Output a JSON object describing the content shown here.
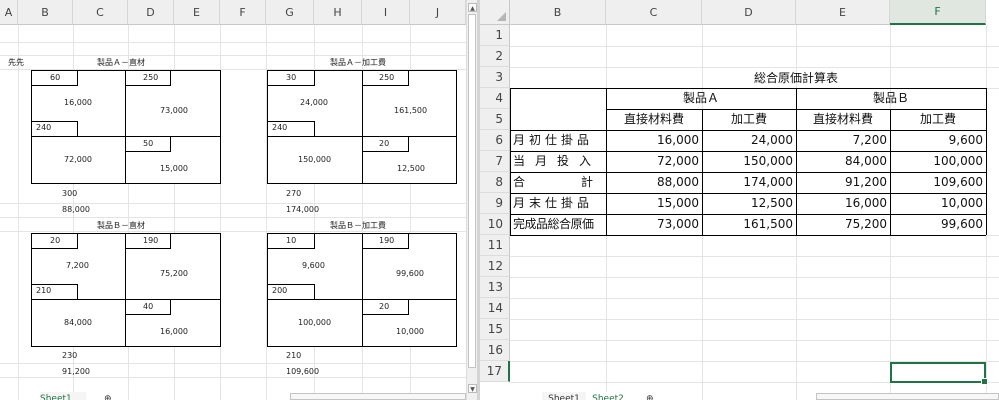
{
  "left_sheet": {
    "columns": [
      "A",
      "B",
      "C",
      "D",
      "E",
      "F",
      "G",
      "H",
      "I",
      "J"
    ],
    "stray_label": "先先",
    "boxes": [
      {
        "title": "製品Ａ－直材",
        "begin_qty": "60",
        "begin_amt": "16,000",
        "input_qty": "240",
        "input_amt": "72,000",
        "completed_qty": "250",
        "completed_amt": "73,000",
        "end_qty": "50",
        "end_amt": "15,000",
        "total_qty": "300",
        "total_amt": "88,000"
      },
      {
        "title": "製品Ａ－加工費",
        "begin_qty": "30",
        "begin_amt": "24,000",
        "input_qty": "240",
        "input_amt": "150,000",
        "completed_qty": "250",
        "completed_amt": "161,500",
        "end_qty": "20",
        "end_amt": "12,500",
        "total_qty": "270",
        "total_amt": "174,000"
      },
      {
        "title": "製品Ｂ－直材",
        "begin_qty": "20",
        "begin_amt": "7,200",
        "input_qty": "210",
        "input_amt": "84,000",
        "completed_qty": "190",
        "completed_amt": "75,200",
        "end_qty": "40",
        "end_amt": "16,000",
        "total_qty": "230",
        "total_amt": "91,200"
      },
      {
        "title": "製品Ｂ－加工費",
        "begin_qty": "10",
        "begin_amt": "9,600",
        "input_qty": "200",
        "input_amt": "100,000",
        "completed_qty": "190",
        "completed_amt": "99,600",
        "end_qty": "20",
        "end_amt": "10,000",
        "total_qty": "210",
        "total_amt": "109,600"
      }
    ],
    "tab_label": "Sheet1",
    "new_sheet_glyph": "⊕"
  },
  "right_sheet": {
    "columns": [
      "B",
      "C",
      "D",
      "E",
      "F"
    ],
    "rows": [
      "1",
      "2",
      "3",
      "4",
      "5",
      "6",
      "7",
      "8",
      "9",
      "10",
      "11",
      "12",
      "13",
      "14",
      "15",
      "16",
      "17"
    ],
    "title": "総合原価計算表",
    "product_a": "製品Ａ",
    "product_b": "製品Ｂ",
    "header_material": "直接材料費",
    "header_processing": "加工費",
    "table_rows": [
      {
        "label": "月初仕掛品",
        "a_mat": "16,000",
        "a_proc": "24,000",
        "b_mat": "7,200",
        "b_proc": "9,600"
      },
      {
        "label": "当月投入",
        "a_mat": "72,000",
        "a_proc": "150,000",
        "b_mat": "84,000",
        "b_proc": "100,000"
      },
      {
        "label": "合計",
        "a_mat": "88,000",
        "a_proc": "174,000",
        "b_mat": "91,200",
        "b_proc": "109,600"
      },
      {
        "label": "月末仕掛品",
        "a_mat": "15,000",
        "a_proc": "12,500",
        "b_mat": "16,000",
        "b_proc": "10,000"
      },
      {
        "label": "完成品総合原価",
        "a_mat": "73,000",
        "a_proc": "161,500",
        "b_mat": "75,200",
        "b_proc": "99,600"
      }
    ],
    "tabs": [
      "Sheet1",
      "Sheet2"
    ],
    "new_sheet_glyph": "⊕"
  },
  "colors": {
    "accent": "#217346",
    "header_bg": "#efefef",
    "grid": "#e4e4e4"
  }
}
